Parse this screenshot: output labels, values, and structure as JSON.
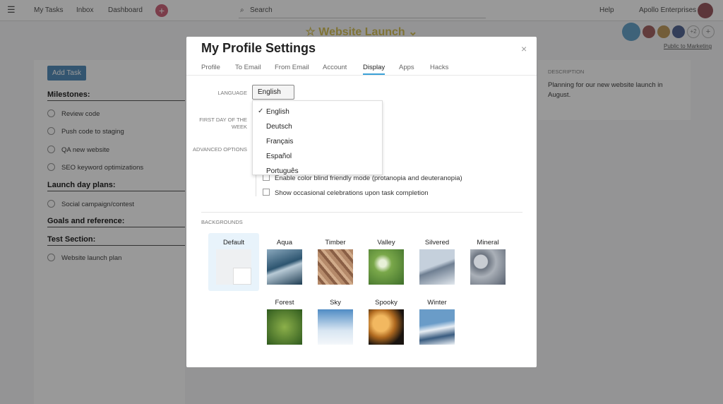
{
  "topbar": {
    "menu_icon": "hamburger-icon",
    "my_tasks": "My Tasks",
    "inbox": "Inbox",
    "dashboard": "Dashboard",
    "search_placeholder": "Search",
    "help": "Help",
    "org": "Apollo Enterprises"
  },
  "project": {
    "title": "Website Launch",
    "members_extra": "+2",
    "privacy": "Public to Marketing"
  },
  "left": {
    "add_task": "Add Task",
    "sections": [
      {
        "title": "Milestones:",
        "tasks": [
          "Review code",
          "Push code to staging",
          "QA new website",
          "SEO keyword optimizations"
        ]
      },
      {
        "title": "Launch day plans:",
        "tasks": [
          "Social campaign/contest"
        ]
      },
      {
        "title": "Goals and reference:",
        "tasks": []
      },
      {
        "title": "Test Section:",
        "tasks": [
          "Website launch plan"
        ]
      }
    ]
  },
  "right": {
    "heading": "DESCRIPTION",
    "text": "Planning for our new website launch in August."
  },
  "modal": {
    "title": "My Profile Settings",
    "close": "×",
    "tabs": [
      "Profile",
      "To Email",
      "From Email",
      "Account",
      "Display",
      "Apps",
      "Hacks"
    ],
    "active_tab": "Display",
    "language_label": "LANGUAGE",
    "language_value": "English",
    "language_options": [
      "English",
      "Deutsch",
      "Français",
      "Español",
      "Português"
    ],
    "first_day_label": "FIRST DAY OF THE WEEK",
    "advanced_label": "ADVANCED OPTIONS",
    "options": [
      {
        "label": "Enable color blind friendly mode (protanopia and deuteranopia)",
        "checked": false
      },
      {
        "label": "Show occasional celebrations upon task completion",
        "checked": false
      }
    ],
    "backgrounds_label": "BACKGROUNDS",
    "backgrounds": [
      "Default",
      "Aqua",
      "Timber",
      "Valley",
      "Silvered",
      "Mineral",
      "Forest",
      "Sky",
      "Spooky",
      "Winter"
    ],
    "selected_background": "Default"
  }
}
